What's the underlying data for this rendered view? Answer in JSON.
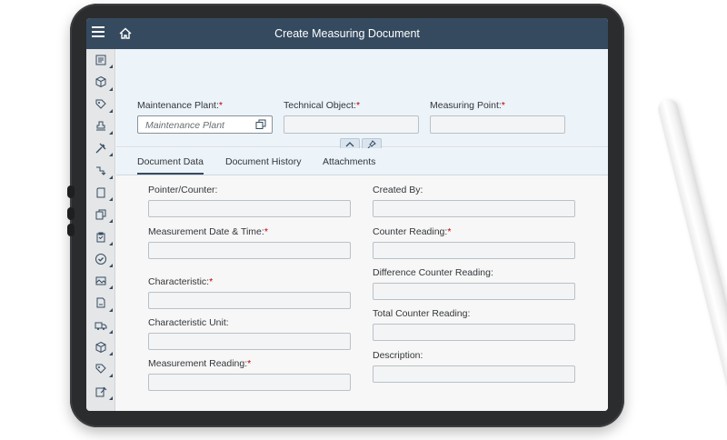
{
  "shell": {
    "title": "Create Measuring Document",
    "menu_icon": "hamburger-icon",
    "home_icon": "home-icon"
  },
  "sidebar": {
    "items": [
      {
        "icon": "document-list-icon"
      },
      {
        "icon": "cube-icon"
      },
      {
        "icon": "tag-icon"
      },
      {
        "icon": "stamp-icon"
      },
      {
        "icon": "tools-icon"
      },
      {
        "icon": "workflow-icon"
      },
      {
        "icon": "notes-icon"
      },
      {
        "icon": "copy-icon"
      },
      {
        "icon": "clipboard-icon"
      },
      {
        "icon": "checkmark-circle-icon"
      },
      {
        "icon": "image-card-icon"
      },
      {
        "icon": "document-icon"
      },
      {
        "icon": "truck-icon"
      },
      {
        "icon": "cube-icon"
      },
      {
        "icon": "tag-icon"
      },
      {
        "icon": "edit-icon"
      }
    ]
  },
  "header": {
    "maintenance_plant_label": "Maintenance Plant:",
    "maintenance_plant_placeholder": "Maintenance Plant",
    "technical_object_label": "Technical Object:",
    "measuring_point_label": "Measuring Point:",
    "required_marker": "*"
  },
  "tabs": [
    "Document Data",
    "Document History",
    "Attachments"
  ],
  "form": {
    "left": [
      {
        "label": "Pointer/Counter:",
        "required": false
      },
      {
        "label": "Measurement Date & Time:",
        "required": true
      },
      {
        "label": "Characteristic:",
        "required": true
      },
      {
        "label": "Characteristic Unit:",
        "required": false
      },
      {
        "label": "Measurement Reading:",
        "required": true
      }
    ],
    "right": [
      {
        "label": "Created By:",
        "required": false
      },
      {
        "label": "Counter Reading:",
        "required": true
      },
      {
        "label": "Difference Counter Reading:",
        "required": false
      },
      {
        "label": "Total Counter Reading:",
        "required": false
      },
      {
        "label": "Description:",
        "required": false
      }
    ]
  },
  "colors": {
    "shell": "#354a5f",
    "required": "#bb0000",
    "header_bg": "#ecf3f9"
  }
}
